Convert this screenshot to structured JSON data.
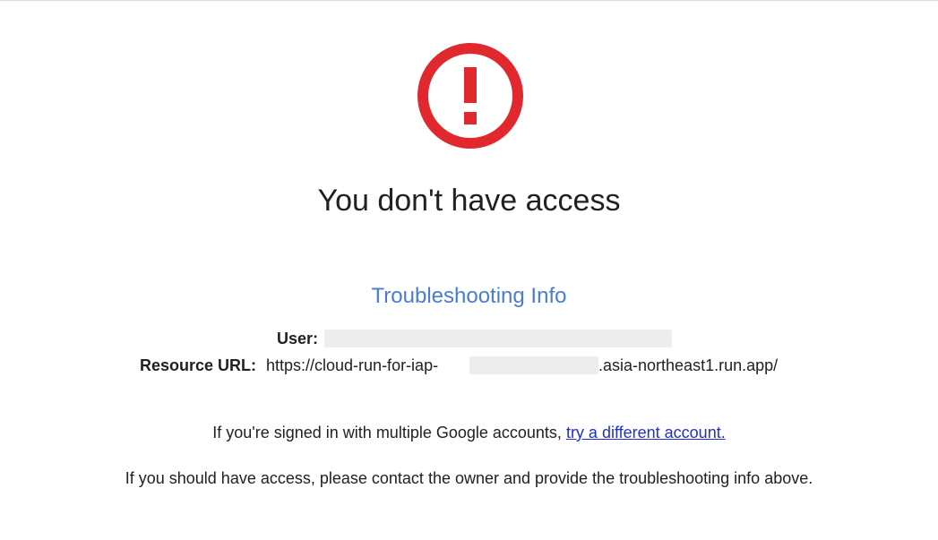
{
  "heading": "You don't have access",
  "icon": "error-exclamation-circle-icon",
  "icon_color": "#e0282e",
  "link_color": "#1f2fd6",
  "section_title_color": "#4a7bd5",
  "troubleshooting": {
    "title": "Troubleshooting Info",
    "user_label": "User:",
    "resource_label": "Resource URL:",
    "resource_url_prefix": "https://cloud-run-for-iap-",
    "resource_url_suffix": ".asia-northeast1.run.app/"
  },
  "messages": {
    "multiple_accounts_prefix": "If you're signed in with multiple Google accounts, ",
    "try_different_account_link": "try a different account.",
    "contact_owner": "If you should have access, please contact the owner and provide the troubleshooting info above."
  }
}
